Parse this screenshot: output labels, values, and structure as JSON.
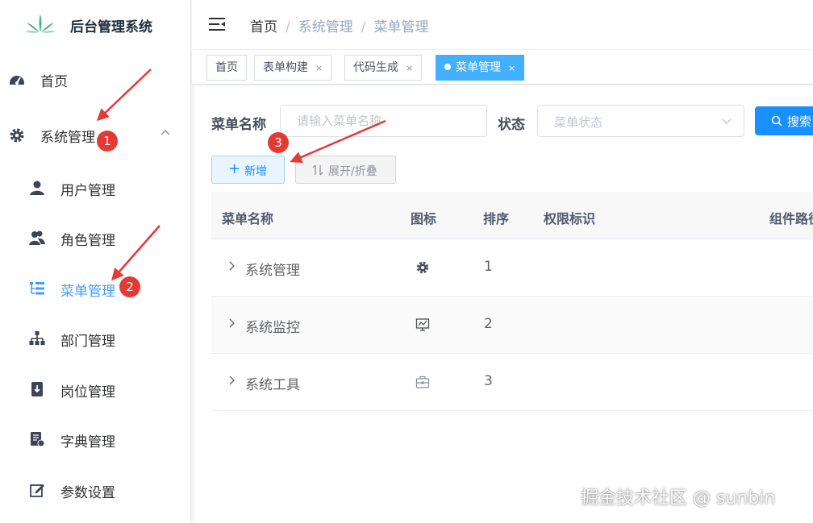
{
  "app": {
    "title": "后台管理系统"
  },
  "sidebar": {
    "items": [
      {
        "label": "首页",
        "icon": "dashboard-icon"
      },
      {
        "label": "系统管理",
        "icon": "gear-icon",
        "expanded": true
      }
    ],
    "sub_items": [
      {
        "label": "用户管理",
        "icon": "user-icon"
      },
      {
        "label": "角色管理",
        "icon": "users-icon"
      },
      {
        "label": "菜单管理",
        "icon": "tree-table-icon",
        "active": true
      },
      {
        "label": "部门管理",
        "icon": "org-tree-icon"
      },
      {
        "label": "岗位管理",
        "icon": "post-icon"
      },
      {
        "label": "字典管理",
        "icon": "dict-icon"
      },
      {
        "label": "参数设置",
        "icon": "edit-icon"
      }
    ]
  },
  "header": {
    "breadcrumb": [
      "首页",
      "系统管理",
      "菜单管理"
    ]
  },
  "tags": [
    {
      "label": "首页"
    },
    {
      "label": "表单构建",
      "close": "×"
    },
    {
      "label": "代码生成",
      "close": "×"
    },
    {
      "label": "菜单管理",
      "close": "×",
      "active": true
    }
  ],
  "search": {
    "menu_name_label": "菜单名称",
    "menu_name_placeholder": "请输入菜单名称",
    "status_label": "状态",
    "status_placeholder": "菜单状态",
    "search_button": "搜索"
  },
  "toolbar": {
    "add_plus": "+",
    "add_label": "新增",
    "expand_label": "展开/折叠"
  },
  "table": {
    "headers": [
      "菜单名称",
      "图标",
      "排序",
      "权限标识",
      "组件路径"
    ],
    "rows": [
      {
        "name": "系统管理",
        "icon": "gear-icon",
        "order": "1"
      },
      {
        "name": "系统监控",
        "icon": "monitor-icon",
        "order": "2"
      },
      {
        "name": "系统工具",
        "icon": "toolbox-icon",
        "order": "3"
      }
    ]
  },
  "annotations": {
    "badges": [
      "1",
      "2",
      "3"
    ]
  },
  "watermark": "掘金技术社区 @ sunbin",
  "colors": {
    "primary": "#1890ff",
    "active_menu": "#409eff",
    "badge": "#e53935"
  }
}
